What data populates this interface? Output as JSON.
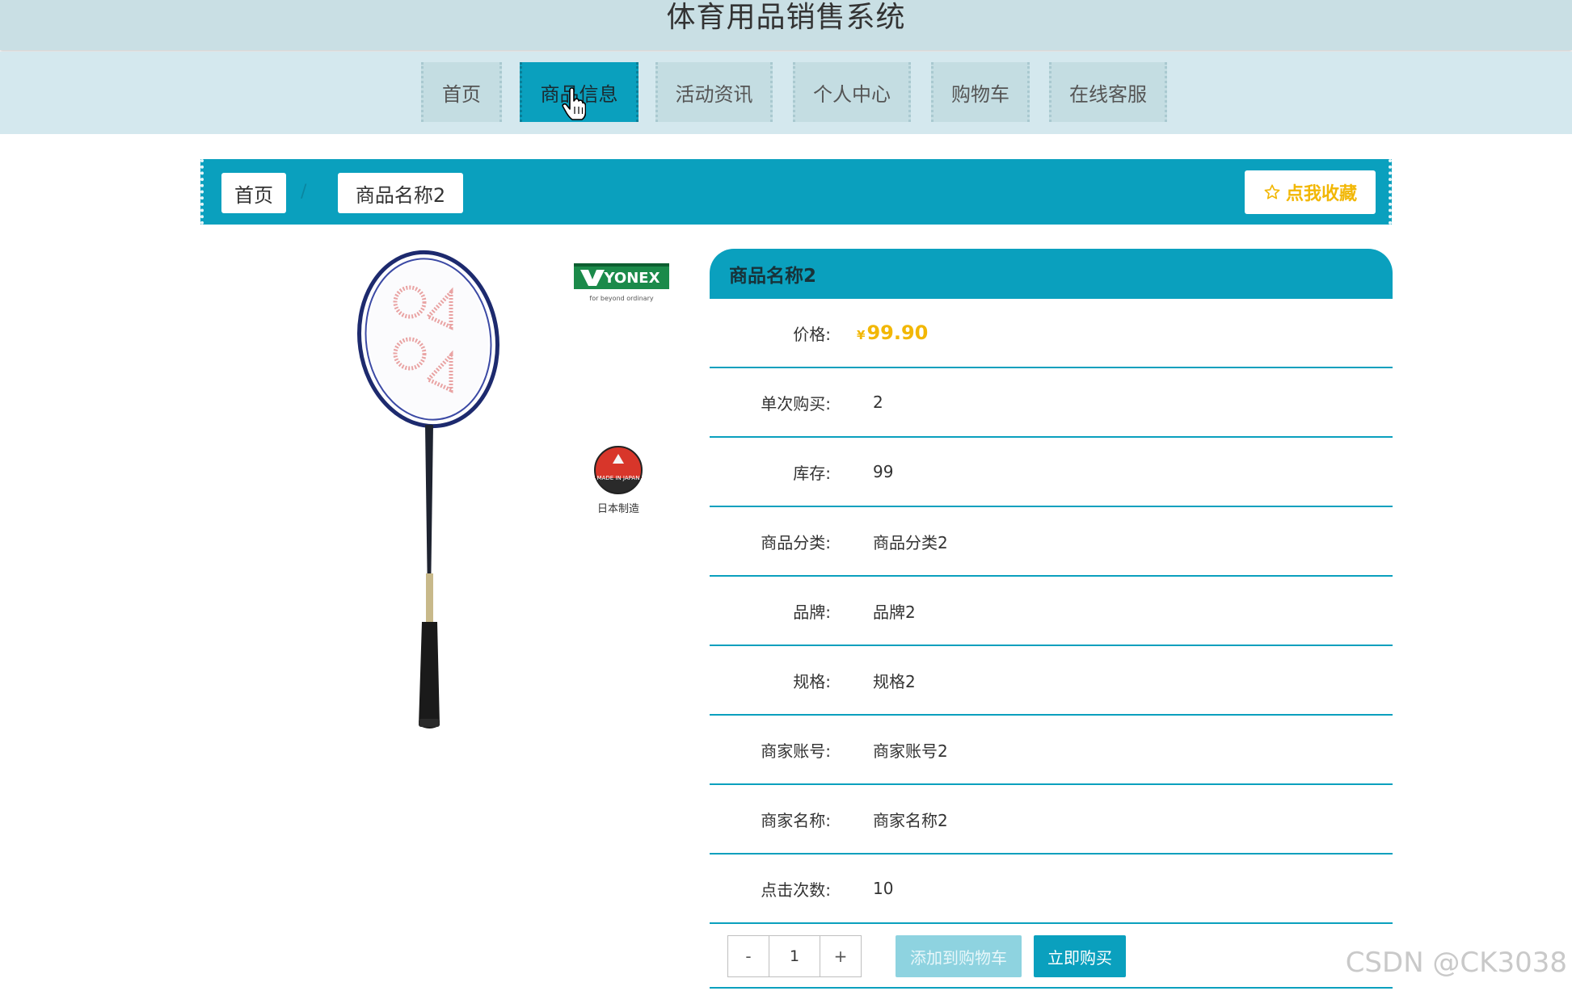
{
  "header": {
    "title": "体育用品销售系统"
  },
  "nav": {
    "items": [
      {
        "label": "首页"
      },
      {
        "label": "商品信息"
      },
      {
        "label": "活动资讯"
      },
      {
        "label": "个人中心"
      },
      {
        "label": "购物车"
      },
      {
        "label": "在线客服"
      }
    ],
    "active": "商品信息"
  },
  "breadcrumb": {
    "home": "首页",
    "separator": "/",
    "current": "商品名称2",
    "favorite_label": "点我收藏"
  },
  "product_image": {
    "brand_logo": "YONEX",
    "brand_tagline": "for beyond ordinary",
    "badge_text": "MADE IN JAPAN",
    "badge_caption": "日本制造"
  },
  "product": {
    "name": "商品名称2",
    "price_label": "价格:",
    "price_currency": "¥",
    "price_value": "99.90",
    "fields": [
      {
        "label": "单次购买:",
        "value": "2"
      },
      {
        "label": "库存:",
        "value": "99"
      },
      {
        "label": "商品分类:",
        "value": "商品分类2"
      },
      {
        "label": "品牌:",
        "value": "品牌2"
      },
      {
        "label": "规格:",
        "value": "规格2"
      },
      {
        "label": "商家账号:",
        "value": "商家账号2"
      },
      {
        "label": "商家名称:",
        "value": "商家名称2"
      },
      {
        "label": "点击次数:",
        "value": "10"
      }
    ]
  },
  "actions": {
    "minus": "-",
    "quantity": "1",
    "plus": "+",
    "add_to_cart": "添加到购物车",
    "buy_now": "立即购买"
  },
  "watermark": "CSDN @CK3038",
  "colors": {
    "accent": "#0aa0be",
    "price": "#f2b705",
    "header_bg": "#c9dfe4"
  }
}
